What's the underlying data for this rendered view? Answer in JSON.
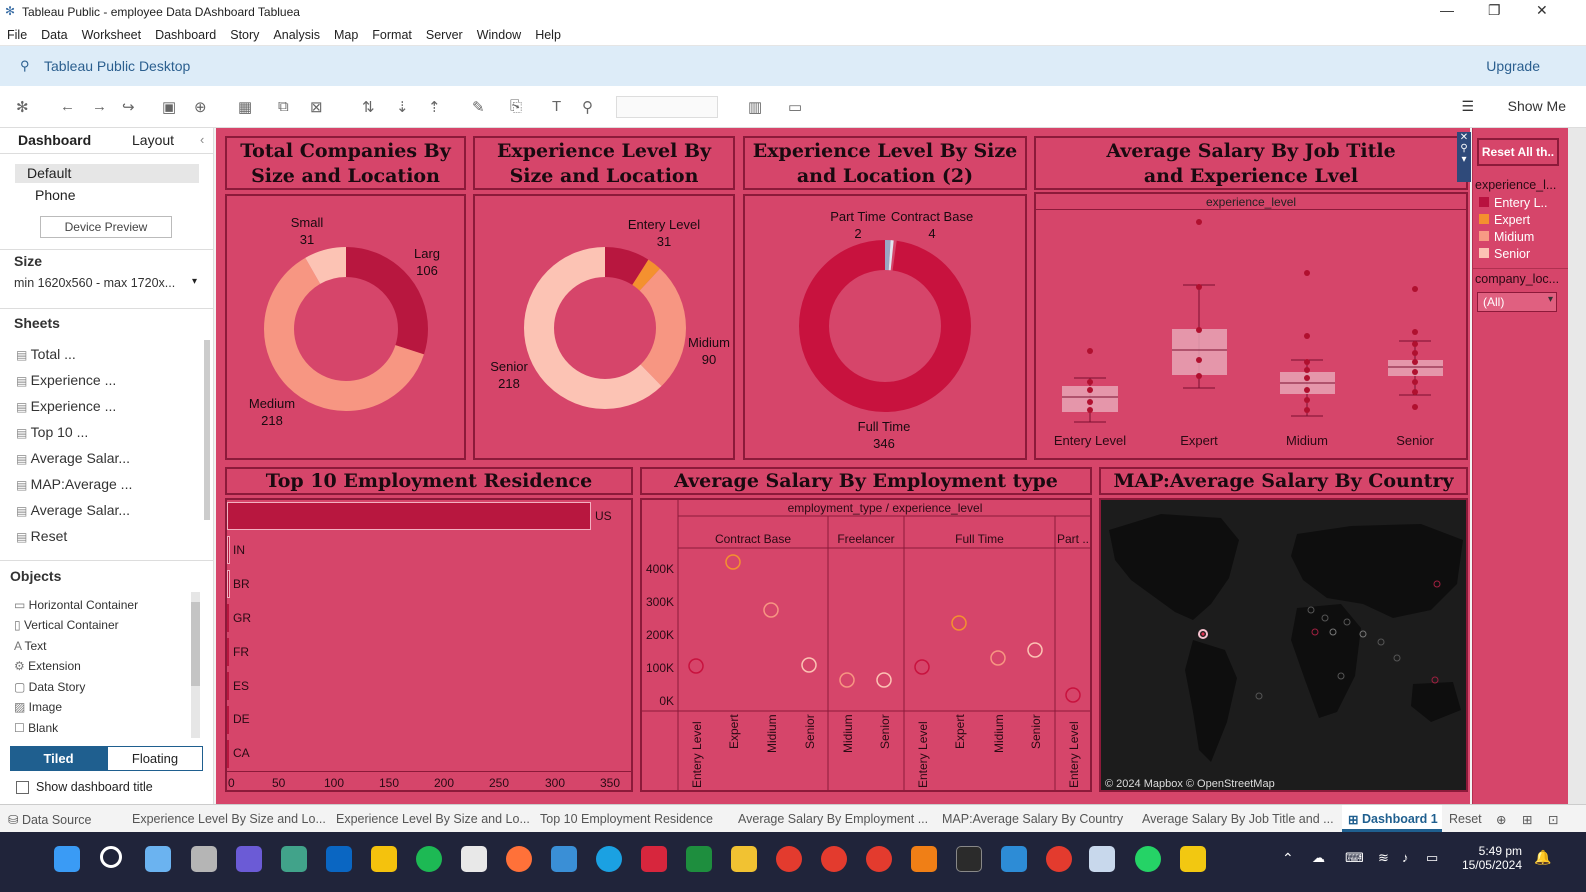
{
  "window": {
    "title": "Tableau Public - employee Data DAshboard Tabluea",
    "minimize": "—",
    "restore": "❐",
    "close": "✕"
  },
  "menu": [
    "File",
    "Data",
    "Worksheet",
    "Dashboard",
    "Story",
    "Analysis",
    "Map",
    "Format",
    "Server",
    "Window",
    "Help"
  ],
  "brand": {
    "name": "Tableau Public Desktop",
    "upgrade": "Upgrade"
  },
  "toolbar": {
    "show_me": "Show Me"
  },
  "left_panel": {
    "tab_dashboard": "Dashboard",
    "tab_layout": "Layout",
    "devices": [
      "Default",
      "Phone"
    ],
    "device_preview": "Device Preview",
    "size_heading": "Size",
    "size_value": "min 1620x560 - max 1720x...",
    "sheets_heading": "Sheets",
    "sheets": [
      "Total ...",
      "Experience ...",
      "Experience ...",
      "Top 10 ...",
      "Average Salar...",
      "MAP:Average ...",
      "Average Salar...",
      "Reset"
    ],
    "objects_heading": "Objects",
    "objects": [
      "Horizontal Container",
      "Vertical Container",
      "Text",
      "Extension",
      "Data Story",
      "Image",
      "Blank"
    ],
    "tiled": "Tiled",
    "floating": "Floating",
    "show_title": "Show dashboard title"
  },
  "titles": {
    "t1": "Total Companies By Size and Location",
    "t2": "Experience Level By Size and Location",
    "t3": "Experience Level By Size and Location (2)",
    "t4": "Average Salary By Job Title and Experience Lvel",
    "t5": "Top 10 Employment  Residence",
    "t6": "Average Salary By Employment type",
    "t7": "MAP:Average Salary By Country"
  },
  "donut1": [
    {
      "label": "Small",
      "value": "31"
    },
    {
      "label": "Larg",
      "value": "106"
    },
    {
      "label": "Medium",
      "value": "218"
    }
  ],
  "donut2": [
    {
      "label": "Entery Level",
      "value": "31"
    },
    {
      "label": "Midium",
      "value": "90"
    },
    {
      "label": "Senior",
      "value": "218"
    }
  ],
  "donut3": [
    {
      "label": "Part Time",
      "value": "2"
    },
    {
      "label": "Contract Base",
      "value": "4"
    },
    {
      "label": "Full Time",
      "value": "346"
    }
  ],
  "box": {
    "header": "experience_level",
    "categories": [
      "Entery Level",
      "Expert",
      "Midium",
      "Senior"
    ]
  },
  "bar": {
    "top_label": "US",
    "countries": [
      "IN",
      "BR",
      "GR",
      "FR",
      "ES",
      "DE",
      "CA"
    ],
    "ticks": [
      "0",
      "50",
      "100",
      "150",
      "200",
      "250",
      "300",
      "350"
    ]
  },
  "scatter": {
    "header": "employment_type / experience_level",
    "groups": [
      "Contract Base",
      "Freelancer",
      "Full Time",
      "Part .."
    ],
    "yticks": [
      "400K",
      "300K",
      "200K",
      "100K",
      "0K"
    ],
    "xlabels": [
      "Entery Level",
      "Expert",
      "Midium",
      "Senior",
      "Midium",
      "Senior",
      "Entery Level",
      "Expert",
      "Midium",
      "Senior",
      "Entery Level"
    ]
  },
  "map": {
    "credit": "© 2024 Mapbox © OpenStreetMap"
  },
  "right_panel": {
    "reset": "Reset All th..",
    "legend_title": "experience_l...",
    "legend": [
      {
        "label": "Entery L..",
        "color": "#b8123f"
      },
      {
        "label": "Expert",
        "color": "#f4912f"
      },
      {
        "label": "Midium",
        "color": "#f79a84"
      },
      {
        "label": "Senior",
        "color": "#fcc3b4"
      }
    ],
    "filter_title": "company_loc...",
    "filter_value": "(All)"
  },
  "tabs": {
    "data_source": "Data Source",
    "items": [
      "Experience Level By Size and Lo...",
      "Experience Level By Size and Lo...",
      "Top 10 Employment  Residence",
      "Average Salary By Employment ...",
      "MAP:Average Salary By Country",
      "Average Salary By Job Title and ..."
    ],
    "active": "Dashboard 1",
    "reset": "Reset"
  },
  "clock": {
    "time": "5:49 pm",
    "date": "15/05/2024"
  },
  "chart_data": [
    {
      "type": "pie",
      "title": "Total Companies By Size and Location",
      "categories": [
        "Larg",
        "Medium",
        "Small"
      ],
      "values": [
        106,
        218,
        31
      ]
    },
    {
      "type": "pie",
      "title": "Experience Level By Size and Location",
      "categories": [
        "Entery Level",
        "Expert",
        "Midium",
        "Senior"
      ],
      "values": [
        31,
        10,
        90,
        218
      ]
    },
    {
      "type": "pie",
      "title": "Experience Level By Size and Location (2)",
      "categories": [
        "Full Time",
        "Part Time",
        "Contract Base"
      ],
      "values": [
        346,
        2,
        4
      ]
    },
    {
      "type": "bar",
      "title": "Top 10 Employment  Residence",
      "categories": [
        "US",
        "IN",
        "BR",
        "GR",
        "FR",
        "ES",
        "DE",
        "CA"
      ],
      "values": [
        332,
        3,
        3,
        2,
        2,
        2,
        2,
        2
      ],
      "xlim": [
        0,
        350
      ]
    }
  ]
}
